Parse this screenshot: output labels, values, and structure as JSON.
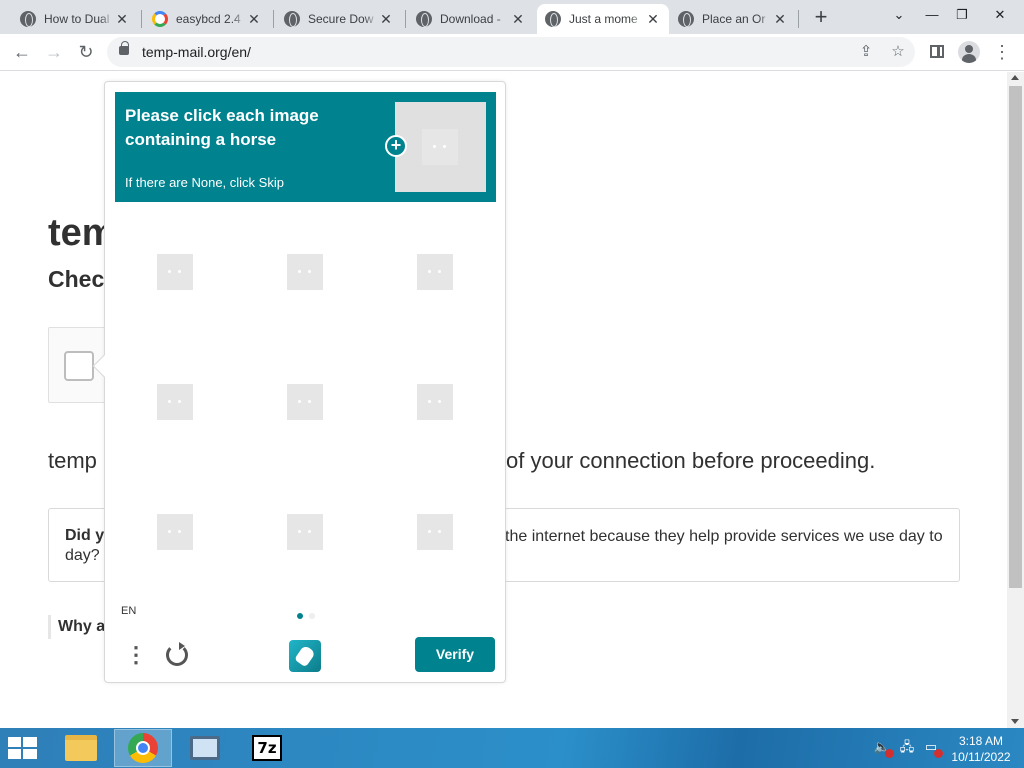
{
  "browser": {
    "tabs": [
      {
        "title": "How to Dual",
        "icon": "globe-icon",
        "active": false
      },
      {
        "title": "easybcd 2.4",
        "icon": "google-icon",
        "active": false
      },
      {
        "title": "Secure Dow",
        "icon": "globe-icon",
        "active": false
      },
      {
        "title": "Download -",
        "icon": "globe-icon",
        "active": false
      },
      {
        "title": "Just a mome",
        "icon": "globe-icon",
        "active": true
      },
      {
        "title": "Place an Or",
        "icon": "globe-icon",
        "active": false
      }
    ],
    "new_tab": "+",
    "url": "temp-mail.org/en/",
    "window_controls": {
      "dropdown": "⌄",
      "minimize": "—",
      "restore": "❐",
      "close": "✕"
    }
  },
  "page": {
    "heading_partial": "tem",
    "subheading_partial": "Check",
    "verify_text_start": "temp",
    "verify_text_end": "of your connection before proceeding.",
    "info_question_start": "Did y",
    "info_body": "the internet because they help provide services we use day to",
    "info_question_line2": "day?",
    "why_partial": "Why a"
  },
  "captcha": {
    "title": "Please click each image containing a horse",
    "subtitle": "If there are None, click Skip",
    "language": "EN",
    "verify_label": "Verify",
    "accent_color": "#00838f",
    "tiles": 9,
    "page_dots": 2,
    "active_page": 1
  },
  "taskbar": {
    "apps": [
      {
        "name": "file-explorer",
        "active": false
      },
      {
        "name": "chrome",
        "active": true
      },
      {
        "name": "computer",
        "active": false
      },
      {
        "name": "7zip",
        "active": false,
        "label": "7z"
      }
    ],
    "time": "3:18 AM",
    "date": "10/11/2022"
  }
}
